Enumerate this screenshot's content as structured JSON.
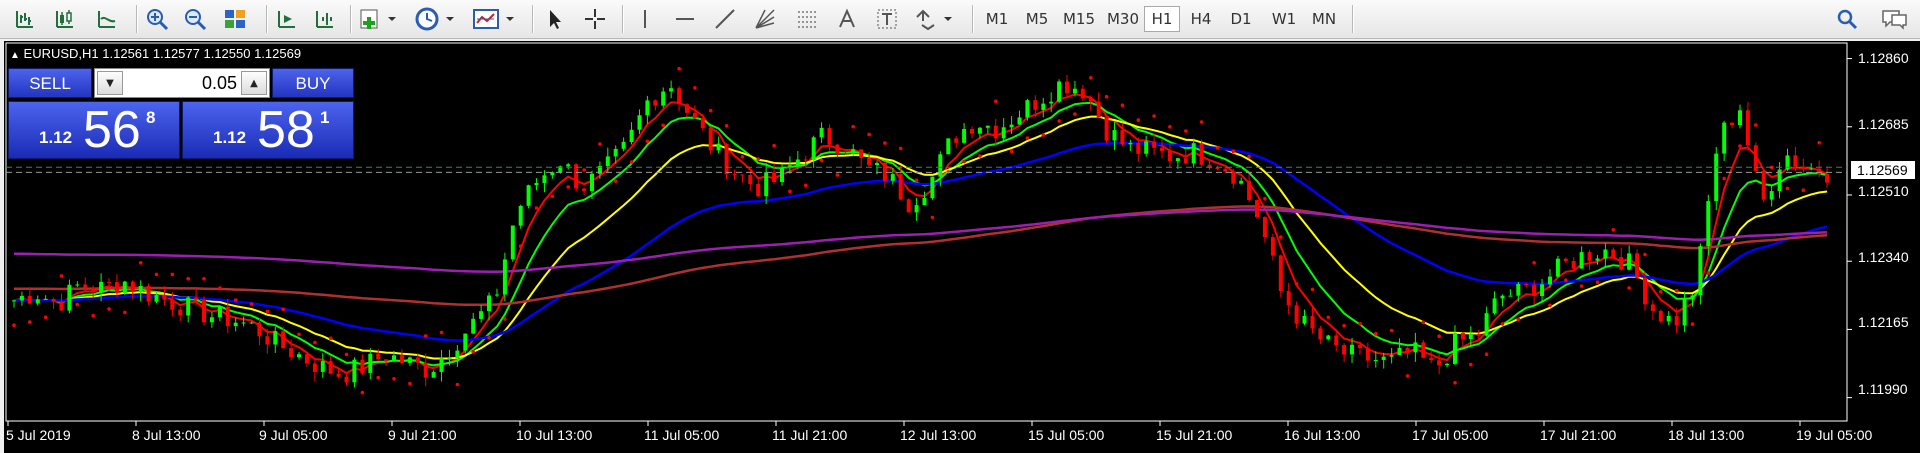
{
  "toolbar": {
    "timeframes": [
      "M1",
      "M5",
      "M15",
      "M30",
      "H1",
      "H4",
      "D1",
      "W1",
      "MN"
    ],
    "active_timeframe": "H1",
    "icons": [
      "bar-chart-icon",
      "candlestick-icon",
      "line-chart-icon",
      "zoom-in-icon",
      "zoom-out-icon",
      "tile-windows-icon",
      "autoscroll-icon",
      "chart-shift-icon",
      "new-indicator-icon",
      "clock-icon",
      "templates-icon",
      "cursor-icon",
      "crosshair-icon",
      "vertical-line-icon",
      "horizontal-line-icon",
      "trendline-icon",
      "fibonacci-fan-icon",
      "fibonacci-icon",
      "text-icon",
      "text-label-icon",
      "arrows-icon",
      "search-icon",
      "chat-icon"
    ]
  },
  "chart": {
    "info": "EURUSD,H1  1.12561 1.12577 1.12550 1.12569",
    "background": "#000000",
    "bull_color": "#00ff00",
    "bear_color": "#ff0000"
  },
  "trade_panel": {
    "sell_label": "SELL",
    "buy_label": "BUY",
    "lot": "0.05",
    "bid_prefix": "1.12",
    "bid_big": "56",
    "bid_sup": "8",
    "ask_prefix": "1.12",
    "ask_big": "58",
    "ask_sup": "1"
  },
  "price_axis": {
    "labels": [
      "1.12860",
      "1.12685",
      "1.12510",
      "1.12340",
      "1.12165",
      "1.11990"
    ],
    "current_price": "1.12569"
  },
  "time_axis": [
    "5 Jul 2019",
    "8 Jul 13:00",
    "9 Jul 05:00",
    "9 Jul 21:00",
    "10 Jul 13:00",
    "11 Jul 05:00",
    "11 Jul 21:00",
    "12 Jul 13:00",
    "15 Jul 05:00",
    "15 Jul 21:00",
    "16 Jul 13:00",
    "17 Jul 05:00",
    "17 Jul 21:00",
    "18 Jul 13:00",
    "19 Jul 05:00"
  ],
  "chart_data": {
    "type": "candlestick",
    "symbol": "EURUSD",
    "timeframe": "H1",
    "ylim": [
      1.1193,
      1.129
    ],
    "close_path": [
      1.1224,
      1.1226,
      1.1223,
      1.1228,
      1.1227,
      1.1229,
      1.1226,
      1.1224,
      1.1222,
      1.122,
      1.1219,
      1.1217,
      1.1213,
      1.121,
      1.1207,
      1.1205,
      1.1207,
      1.121,
      1.1208,
      1.1206,
      1.1212,
      1.1218,
      1.1224,
      1.1247,
      1.1255,
      1.126,
      1.1253,
      1.1257,
      1.1263,
      1.1275,
      1.128,
      1.1271,
      1.1263,
      1.1257,
      1.1253,
      1.1255,
      1.1261,
      1.1266,
      1.1264,
      1.1258,
      1.1256,
      1.1249,
      1.1255,
      1.1266,
      1.127,
      1.1268,
      1.1272,
      1.1276,
      1.128,
      1.1278,
      1.1268,
      1.1263,
      1.1262,
      1.1261,
      1.1262,
      1.126,
      1.1256,
      1.1245,
      1.1226,
      1.1218,
      1.1213,
      1.121,
      1.1209,
      1.1208,
      1.1211,
      1.1206,
      1.1213,
      1.1215,
      1.1225,
      1.1226,
      1.1229,
      1.1233,
      1.1236,
      1.1237,
      1.1233,
      1.1222,
      1.1218,
      1.1228,
      1.1265,
      1.1274,
      1.1248,
      1.1262,
      1.1258,
      1.1257
    ],
    "bid": 1.12568,
    "ask": 1.12581,
    "moving_averages": [
      {
        "color": "#ff0000"
      },
      {
        "color": "#00ff00"
      },
      {
        "color": "#ffff00"
      },
      {
        "color": "#0000ff"
      },
      {
        "color": "#b03030"
      },
      {
        "color": "#9b1fb0"
      }
    ],
    "parabolic_sar_color": "#ff0000",
    "grid": false
  }
}
